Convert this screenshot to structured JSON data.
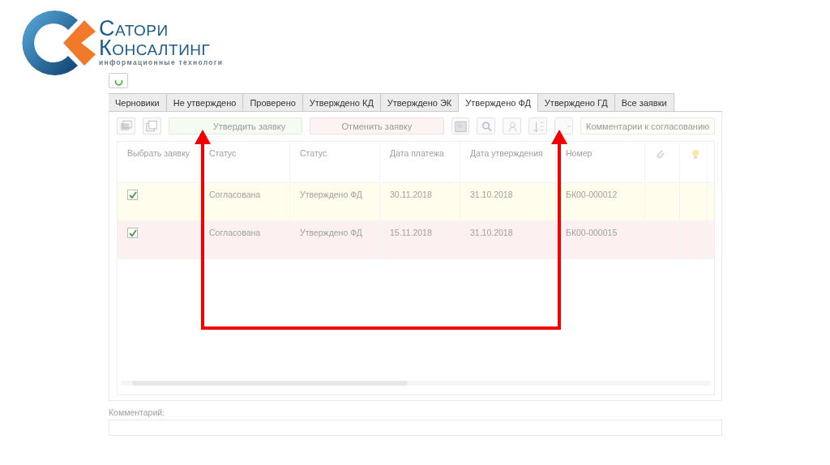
{
  "logo": {
    "line1": "Сатори",
    "line2": "Консалтинг",
    "tagline": "информационные технологи"
  },
  "tabs": [
    {
      "label": "Черновики",
      "selected": false
    },
    {
      "label": "Не утверждено",
      "selected": false
    },
    {
      "label": "Проверено",
      "selected": false
    },
    {
      "label": "Утверждено КД",
      "selected": false
    },
    {
      "label": "Утверждено ЭК",
      "selected": false
    },
    {
      "label": "Утверждено ФД",
      "selected": true
    },
    {
      "label": "Утверждено ГД",
      "selected": false
    },
    {
      "label": "Все заявки",
      "selected": false
    }
  ],
  "panel": {
    "toolbar": [
      {
        "kind": "approve",
        "label": "Утвердить заявку"
      },
      {
        "kind": "cancel",
        "label": "Отменить заявку"
      },
      {
        "kind": "plain",
        "label": "Комментарии к согласованию"
      }
    ],
    "table": {
      "columns": [
        "Выбрать заявку",
        "Статус",
        "Статус",
        "Дата платежа",
        "Дата утверждения",
        "Номер"
      ],
      "rows": [
        {
          "checked": true,
          "color": "#fffdeb",
          "cells": [
            "",
            "Согласована",
            "Утверждено ФД",
            "30.11.2018",
            "31.10.2018",
            "БК00-000012"
          ]
        },
        {
          "checked": true,
          "color": "#fdf0f0",
          "cells": [
            "",
            "Согласована",
            "Утверждено ФД",
            "15.11.2018",
            "31.10.2018",
            "БК00-000015"
          ]
        }
      ]
    },
    "comment": {
      "label": "Комментарий:"
    }
  }
}
